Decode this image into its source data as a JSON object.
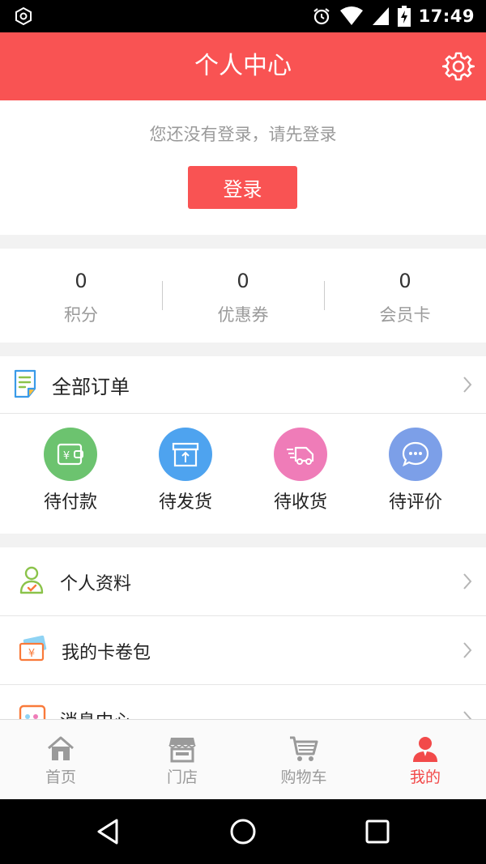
{
  "status_bar": {
    "time": "17:49"
  },
  "header": {
    "title": "个人中心"
  },
  "login": {
    "prompt": "您还没有登录，请先登录",
    "button_label": "登录"
  },
  "stats": [
    {
      "value": "0",
      "label": "积分"
    },
    {
      "value": "0",
      "label": "优惠券"
    },
    {
      "value": "0",
      "label": "会员卡"
    }
  ],
  "orders": {
    "all_label": "全部订单",
    "items": [
      {
        "label": "待付款",
        "icon": "wallet-icon",
        "color": "#6cc36f"
      },
      {
        "label": "待发货",
        "icon": "box-icon",
        "color": "#4ea3ef"
      },
      {
        "label": "待收货",
        "icon": "truck-icon",
        "color": "#ef7cb8"
      },
      {
        "label": "待评价",
        "icon": "chat-icon",
        "color": "#7c9fe8"
      }
    ]
  },
  "menu": [
    {
      "label": "个人资料",
      "icon": "person-icon"
    },
    {
      "label": "我的卡卷包",
      "icon": "voucher-icon"
    },
    {
      "label": "消息中心",
      "icon": "message-icon"
    }
  ],
  "tabs": [
    {
      "label": "首页",
      "icon": "home-icon"
    },
    {
      "label": "门店",
      "icon": "store-icon"
    },
    {
      "label": "购物车",
      "icon": "cart-icon"
    },
    {
      "label": "我的",
      "icon": "me-icon",
      "active": true
    }
  ],
  "colors": {
    "accent": "#f95353",
    "active_tab": "#f24a4a"
  }
}
